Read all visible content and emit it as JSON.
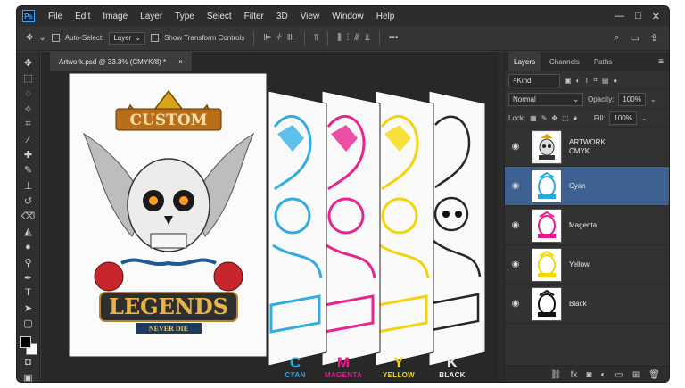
{
  "app": {
    "logo": "Ps"
  },
  "menu": [
    "File",
    "Edit",
    "Image",
    "Layer",
    "Type",
    "Select",
    "Filter",
    "3D",
    "View",
    "Window",
    "Help"
  ],
  "window_controls": [
    "—",
    "□",
    "✕"
  ],
  "options_bar": {
    "auto_select_label": "Auto-Select:",
    "auto_select_value": "Layer",
    "transform_label": "Show Transform Controls",
    "more": "•••"
  },
  "document": {
    "tab_title": "Artwork.psd @ 33.3% (CMYK/8) *",
    "close": "×"
  },
  "artwork": {
    "title_top": "CUSTOM",
    "title_main": "LEGENDS",
    "subtitle": "NEVER DIE"
  },
  "plates": [
    {
      "letter": "C",
      "name": "CYAN",
      "color": "#29a8e0"
    },
    {
      "letter": "M",
      "name": "MAGENTA",
      "color": "#e8198b"
    },
    {
      "letter": "Y",
      "name": "YELLOW",
      "color": "#f5d800"
    },
    {
      "letter": "K",
      "name": "BLACK",
      "color": "#e6e6e6"
    }
  ],
  "layers_panel": {
    "tabs": [
      "Layers",
      "Channels",
      "Paths"
    ],
    "filter_label": "Kind",
    "blend_mode": "Normal",
    "opacity_label": "Opacity:",
    "opacity_value": "100%",
    "lock_label": "Lock:",
    "fill_label": "Fill:",
    "fill_value": "100%",
    "layers": [
      {
        "name": "ARTWORK\nCMYK",
        "selected": false
      },
      {
        "name": "Cyan",
        "selected": true
      },
      {
        "name": "Magenta",
        "selected": false
      },
      {
        "name": "Yellow",
        "selected": false
      },
      {
        "name": "Black",
        "selected": false
      }
    ]
  }
}
